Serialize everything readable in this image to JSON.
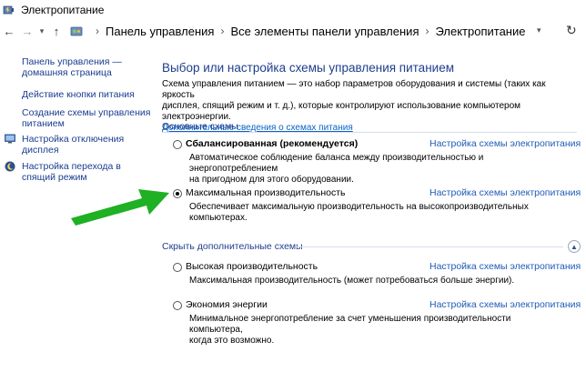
{
  "window": {
    "title": "Электропитание"
  },
  "nav": {
    "back_icon": "arrow-left-icon",
    "forward_icon": "arrow-right-icon",
    "up_icon": "arrow-up-icon"
  },
  "breadcrumb": {
    "items": [
      "Панель управления",
      "Все элементы панели управления",
      "Электропитание"
    ],
    "separator": "›"
  },
  "sidebar": {
    "items": [
      {
        "label_line1": "Панель управления —",
        "label_line2": "домашняя страница"
      },
      {
        "label_line1": "Действие кнопки питания"
      },
      {
        "label_line1": "Создание схемы управления",
        "label_line2": "питанием"
      },
      {
        "label_line1": "Настройка отключения",
        "label_line2": "дисплея",
        "icon": "monitor-icon"
      },
      {
        "label_line1": "Настройка перехода в",
        "label_line2": "спящий режим",
        "icon": "moon-icon"
      }
    ]
  },
  "main": {
    "title": "Выбор или настройка схемы управления питанием",
    "intro_line1": "Схема управления питанием — это набор параметров оборудования и системы (таких как яркость",
    "intro_line2": "дисплея, спящий режим и т. д.), которые контролируют использование компьютером электроэнергии.",
    "intro_link": "Дополнительные сведения о схемах питания",
    "preferred_header": "Основные схемы",
    "hidden_header": "Скрыть дополнительные схемы",
    "plan_link_label": "Настройка схемы электропитания",
    "plans": [
      {
        "name": "Сбалансированная (рекомендуется)",
        "desc_line1": "Автоматическое соблюдение баланса между производительностью и энергопотреблением",
        "desc_line2": "на пригодном для этого оборудовании.",
        "checked": false
      },
      {
        "name": "Максимальная производительность",
        "desc_line1": "Обеспечивает максимальную производительность на высокопроизводительных",
        "desc_line2": "компьютерах.",
        "checked": true
      },
      {
        "name": "Высокая производительность",
        "desc_line1": "Максимальная производительность (может потребоваться больше энергии).",
        "desc_line2": "",
        "checked": false
      },
      {
        "name": "Экономия энергии",
        "desc_line1": "Минимальное энергопотребление за счет уменьшения производительности компьютера,",
        "desc_line2": "когда это возможно.",
        "checked": false
      }
    ]
  },
  "annotation": {
    "arrow_color": "#1fb024"
  },
  "colors": {
    "link": "#1e5bb8",
    "heading": "#1e3e8c"
  }
}
